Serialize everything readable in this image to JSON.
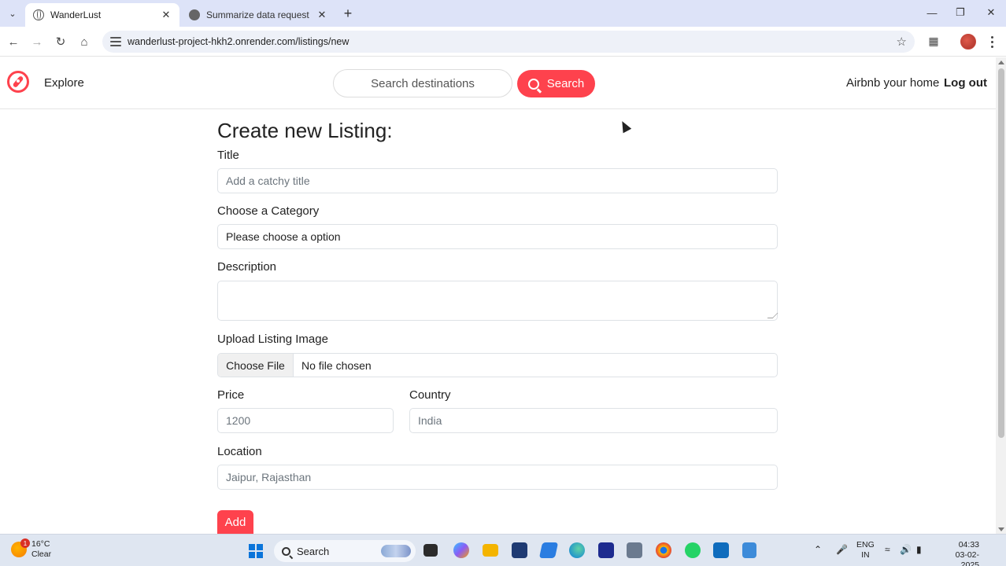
{
  "browser": {
    "tabs": [
      {
        "label": "WanderLust",
        "active": true
      },
      {
        "label": "Summarize data request",
        "active": false
      }
    ],
    "url": "wanderlust-project-hkh2.onrender.com/listings/new"
  },
  "navbar": {
    "explore": "Explore",
    "search_placeholder": "Search destinations",
    "search_button": "Search",
    "airbnb_home": "Airbnb your home",
    "logout": "Log out"
  },
  "form": {
    "title": "Create new Listing:",
    "title_label": "Title",
    "title_placeholder": "Add a catchy title",
    "category_label": "Choose a Category",
    "category_value": "Please choose a option",
    "description_label": "Description",
    "image_label": "Upload Listing Image",
    "file_button": "Choose File",
    "file_status": "No file chosen",
    "price_label": "Price",
    "price_value": "1200",
    "country_label": "Country",
    "country_value": "India",
    "location_label": "Location",
    "location_value": "Jaipur, Rajasthan",
    "submit": "Add"
  },
  "taskbar": {
    "weather_temp": "16°C",
    "weather_desc": "Clear",
    "weather_badge": "1",
    "search_label": "Search",
    "lang_top": "ENG",
    "lang_bottom": "IN",
    "time": "04:33",
    "date": "03-02-2025"
  },
  "colors": {
    "brand": "#fe424d",
    "tabstrip": "#dde3f8",
    "taskbar": "#dfe6f1"
  }
}
